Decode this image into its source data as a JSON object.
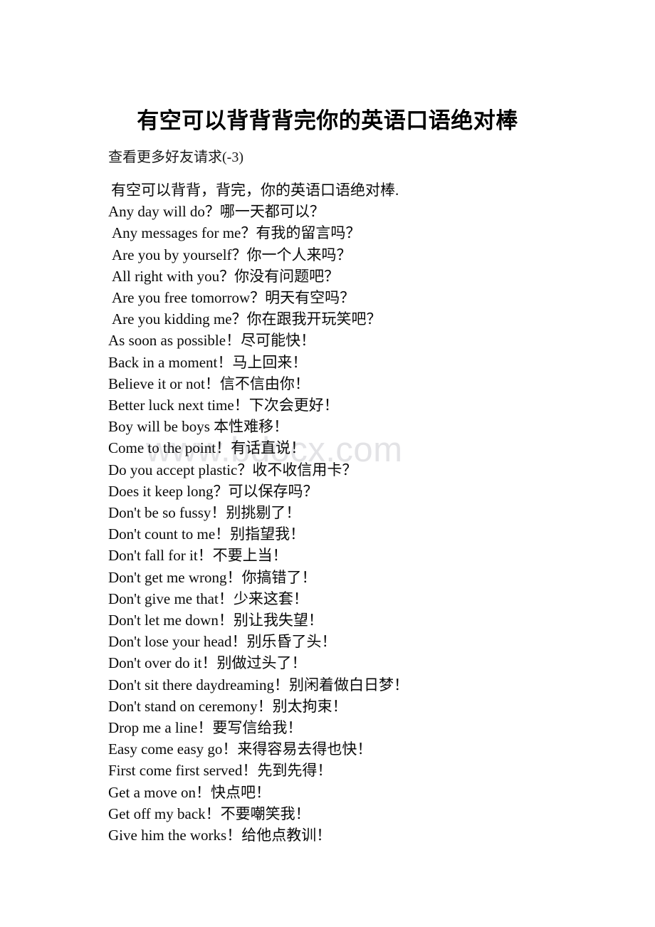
{
  "document": {
    "title": "有空可以背背背完你的英语口语绝对棒",
    "subtitle": "查看更多好友请求(-3)",
    "watermark": "www.bdocx.com",
    "watermark_color": "#e3e3e6",
    "text_color": "#000000",
    "background_color": "#ffffff",
    "lines": [
      "有空可以背背，背完，你的英语口语绝对棒.",
      "Any day will do？哪一天都可以？",
      "Any messages for me？有我的留言吗？",
      "Are you by yourself？你一个人来吗？",
      "All right with you？你没有问题吧？",
      "Are you free tomorrow？明天有空吗？",
      "Are you kidding me？你在跟我开玩笑吧？",
      "As soon as possible！尽可能快！",
      "Back in a moment！马上回来！",
      "Believe it or not！信不信由你！",
      "Better luck next time！下次会更好！",
      "Boy will be boys 本性难移！",
      "Come to the point！有话直说！",
      "Do you accept plastic？收不收信用卡？",
      "Does it keep long？可以保存吗？",
      "Don't be so fussy！别挑剔了！",
      "Don't count to me！别指望我！",
      "Don't fall for it！不要上当！",
      "Don't get me wrong！你搞错了！",
      "Don't give me that！少来这套！",
      "Don't let me down！别让我失望！",
      "Don't lose your head！别乐昏了头！",
      "Don't over do it！别做过头了！",
      "Don't sit there daydreaming！别闲着做白日梦！",
      "Don't stand on ceremony！别太拘束！",
      "Drop me a line！要写信给我！",
      "Easy come easy go！来得容易去得也快！",
      "First come first served！先到先得！",
      "Get a move on！快点吧！",
      "Get off my back！不要嘲笑我！",
      "Give him the works！给他点教训！"
    ]
  }
}
